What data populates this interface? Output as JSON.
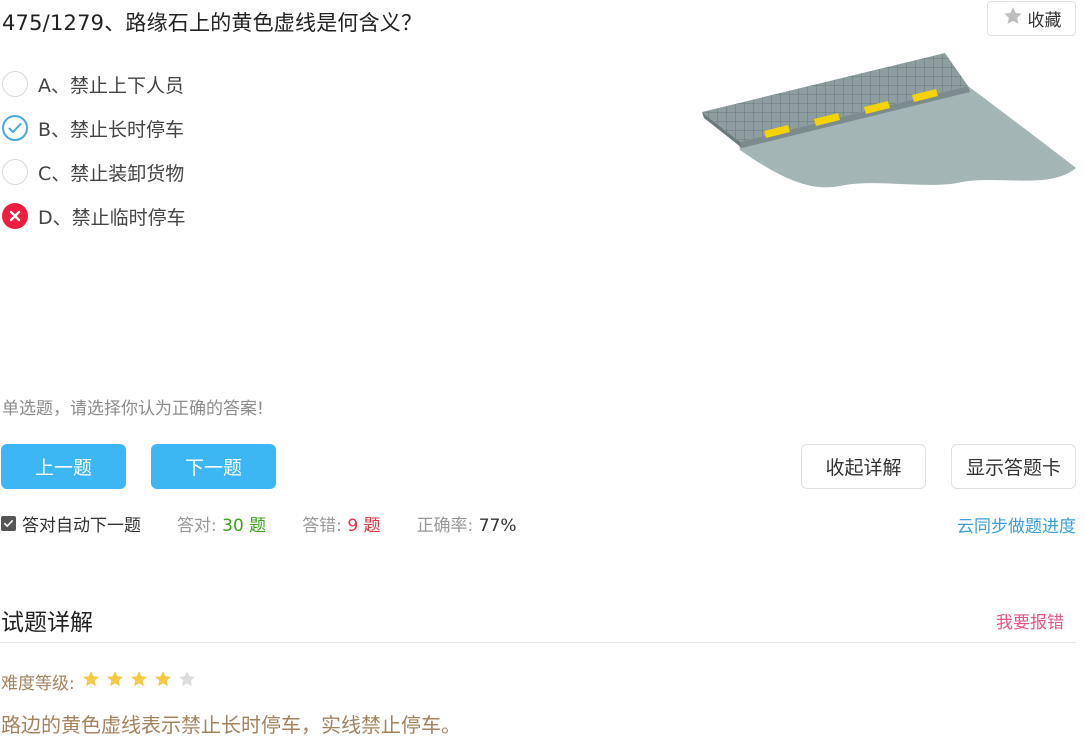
{
  "question": {
    "title": "475/1279、路缘石上的黄色虚线是何含义？"
  },
  "favorite": {
    "label": "收藏",
    "icon": "star-icon"
  },
  "options": [
    {
      "label": "A、禁止上下人员",
      "state": "unselected"
    },
    {
      "label": "B、禁止长时停车",
      "state": "correct"
    },
    {
      "label": "C、禁止装卸货物",
      "state": "unselected"
    },
    {
      "label": "D、禁止临时停车",
      "state": "wrong"
    }
  ],
  "hint": "单选题，请选择你认为正确的答案!",
  "buttons": {
    "prev": "上一题",
    "next": "下一题",
    "collapse": "收起详解",
    "answer_card": "显示答题卡"
  },
  "stats": {
    "auto_next_label": "答对自动下一题",
    "auto_next_checked": true,
    "correct_label": "答对:",
    "correct_value": "30 题",
    "wrong_label": "答错:",
    "wrong_value": "9 题",
    "rate_label": "正确率:",
    "rate_value": "77%"
  },
  "sync_link": "云同步做题进度",
  "explanation": {
    "section_title": "试题详解",
    "report_link": "我要报错",
    "difficulty_label": "难度等级:",
    "difficulty_stars": 4,
    "difficulty_max": 5,
    "text": "路边的黄色虚线表示禁止长时停车，实线禁止停车。"
  },
  "colors": {
    "primary": "#3db6f4",
    "correct": "#47a8e4",
    "wrong": "#ef1d3e",
    "star_on": "#f7c844",
    "star_off": "#dcdcdc",
    "explain_text": "#a4835c",
    "report": "#e85483"
  }
}
